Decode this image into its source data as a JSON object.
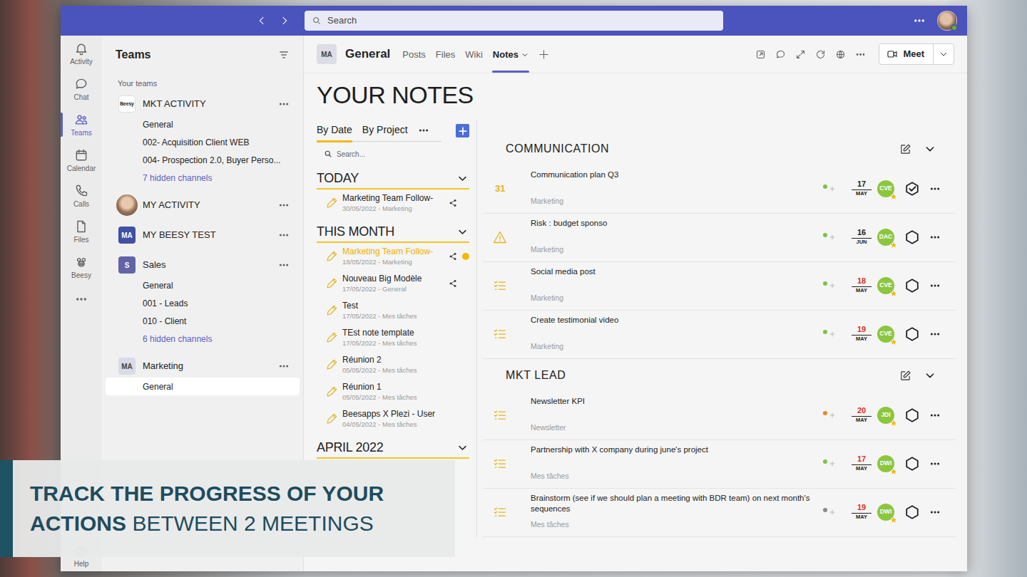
{
  "topbar": {
    "search": {
      "placeholder": "Search"
    }
  },
  "rail": {
    "items": [
      {
        "label": "Activity",
        "selected": false
      },
      {
        "label": "Chat",
        "selected": false
      },
      {
        "label": "Teams",
        "selected": true
      },
      {
        "label": "Calendar",
        "selected": false
      },
      {
        "label": "Calls",
        "selected": false
      },
      {
        "label": "Files",
        "selected": false
      },
      {
        "label": "Beesy",
        "selected": false
      }
    ],
    "help": "Help"
  },
  "teams_panel": {
    "title": "Teams",
    "section": "Your teams",
    "teams": [
      {
        "name": "MKT ACTIVITY",
        "avatar": {
          "kind": "logo",
          "text": "Beesy",
          "color": "#ffffff"
        },
        "channels": [
          {
            "name": "General",
            "selected": false
          },
          {
            "name": "002- Acquisition Client WEB",
            "selected": false
          },
          {
            "name": "004- Prospection 2.0, Buyer Perso...",
            "selected": false
          }
        ],
        "hidden": "7 hidden channels"
      },
      {
        "name": "MY ACTIVITY",
        "avatar": {
          "kind": "photo",
          "color": "#b58f72"
        },
        "channels": []
      },
      {
        "name": "MY BEESY TEST",
        "avatar": {
          "kind": "initials",
          "text": "MA",
          "color": "#3f51a3"
        },
        "channels": []
      },
      {
        "name": "Sales",
        "avatar": {
          "kind": "initials",
          "text": "S",
          "color": "#6264a7"
        },
        "channels": [
          {
            "name": "General",
            "selected": false
          },
          {
            "name": "001 - Leads",
            "selected": false
          },
          {
            "name": "010 - Client",
            "selected": false
          }
        ],
        "hidden": "6 hidden channels"
      },
      {
        "name": "Marketing",
        "avatar": {
          "kind": "initials",
          "text": "MA",
          "color": "#d9dbe6"
        },
        "channels": [
          {
            "name": "General",
            "selected": true
          }
        ]
      }
    ]
  },
  "channel_header": {
    "avatar": "MA",
    "title": "General",
    "tabs": [
      {
        "label": "Posts",
        "selected": false
      },
      {
        "label": "Files",
        "selected": false
      },
      {
        "label": "Wiki",
        "selected": false
      },
      {
        "label": "Notes",
        "selected": true
      }
    ],
    "meet": "Meet"
  },
  "notes": {
    "title": "YOUR NOTES",
    "tabs": [
      {
        "label": "By Date",
        "selected": true
      },
      {
        "label": "By Project",
        "selected": false
      }
    ],
    "search": {
      "placeholder": "Search..."
    },
    "sections": [
      {
        "label": "TODAY",
        "expanded": true,
        "items": [
          {
            "title": "Marketing Team Follow-",
            "meta": "30/05/2022 - Marketing",
            "shared": true,
            "unread": false,
            "selected": false
          }
        ]
      },
      {
        "label": "THIS MONTH",
        "expanded": true,
        "items": [
          {
            "title": "Marketing Team Follow-",
            "meta": "18/05/2022 - Marketing",
            "shared": true,
            "unread": true,
            "selected": true
          },
          {
            "title": "Nouveau Big Modèle",
            "meta": "17/05/2022 - General",
            "shared": true,
            "unread": false,
            "selected": false
          },
          {
            "title": "Test",
            "meta": "17/05/2022 - Mes tâches",
            "shared": false,
            "unread": false,
            "selected": false
          },
          {
            "title": "TEst note template",
            "meta": "17/05/2022 - Mes tâches",
            "shared": false,
            "unread": false,
            "selected": false
          },
          {
            "title": "Réunion 2",
            "meta": "05/05/2022 - Mes tâches",
            "shared": false,
            "unread": false,
            "selected": false
          },
          {
            "title": "Réunion 1",
            "meta": "05/05/2022 - Mes tâches",
            "shared": false,
            "unread": false,
            "selected": false
          },
          {
            "title": "Beesapps X Plezi - User",
            "meta": "04/05/2022 - Mes tâches",
            "shared": false,
            "unread": false,
            "selected": false
          }
        ]
      },
      {
        "label": "APRIL 2022",
        "expanded": true,
        "items": []
      }
    ]
  },
  "board": {
    "groups": [
      {
        "title": "COMMUNICATION",
        "expanded": true,
        "rows": [
          {
            "kind": "event",
            "icon_text": "31",
            "title": "Communication plan Q3",
            "project": "Marketing",
            "dot": "#7cc242",
            "day": "17",
            "month": "MAY",
            "overdue": false,
            "assignee": "CVE",
            "done": true
          },
          {
            "kind": "risk",
            "title": "Risk : budget sponso",
            "project": "Marketing",
            "dot": "#7cc242",
            "day": "16",
            "month": "JUN",
            "overdue": false,
            "assignee": "DAC",
            "done": false
          },
          {
            "kind": "task",
            "title": "Social media post",
            "project": "Marketing",
            "dot": "#7cc242",
            "day": "18",
            "month": "MAY",
            "overdue": true,
            "assignee": "CVE",
            "done": false
          },
          {
            "kind": "task",
            "title": "Create testimonial video",
            "project": "Marketing",
            "dot": "#7cc242",
            "day": "19",
            "month": "MAY",
            "overdue": true,
            "assignee": "CVE",
            "done": false
          }
        ]
      },
      {
        "title": "MKT LEAD",
        "expanded": true,
        "rows": [
          {
            "kind": "task",
            "title": "Newsletter KPI",
            "project": "Newsletter",
            "dot": "#e8892b",
            "day": "20",
            "month": "MAY",
            "overdue": true,
            "assignee": "JDI",
            "done": false
          },
          {
            "kind": "task",
            "title": "Partnership with X company during june's project",
            "project": "Mes tâches",
            "dot": "#7cc242",
            "day": "17",
            "month": "MAY",
            "overdue": true,
            "assignee": "DWI",
            "done": false
          },
          {
            "kind": "task",
            "title": "Brainstorm (see if we should plan a meeting with BDR team) on next month's sequences",
            "project": "Mes tâches",
            "dot": "#8a8a8a",
            "day": "19",
            "month": "MAY",
            "overdue": true,
            "assignee": "DWI",
            "done": false
          }
        ]
      }
    ]
  },
  "banner": {
    "lines": [
      [
        {
          "text": "TRACK THE PROGRESS OF YOUR",
          "bold": true
        }
      ],
      [
        {
          "text": "ACTIONS",
          "bold": true
        },
        {
          "text": "BETWEEN 2 MEETINGS",
          "bold": false
        }
      ]
    ]
  }
}
